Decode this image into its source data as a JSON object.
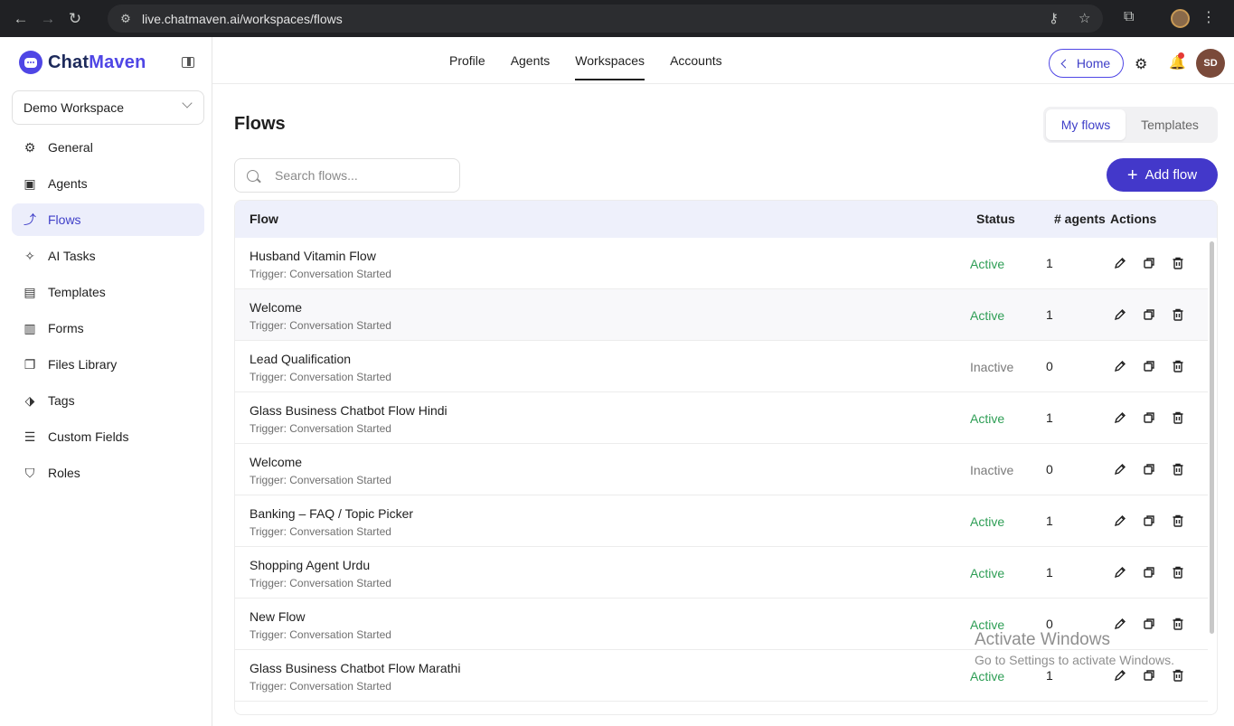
{
  "browser": {
    "url": "live.chatmaven.ai/workspaces/flows"
  },
  "brand": {
    "prefix": "Chat",
    "suffix": "Maven"
  },
  "workspace": {
    "selected": "Demo Workspace"
  },
  "sidebar": {
    "items": [
      {
        "label": "General",
        "icon": "gear-icon",
        "active": false
      },
      {
        "label": "Agents",
        "icon": "robot-icon",
        "active": false
      },
      {
        "label": "Flows",
        "icon": "flow-icon",
        "active": true
      },
      {
        "label": "AI Tasks",
        "icon": "sparkle-icon",
        "active": false
      },
      {
        "label": "Templates",
        "icon": "document-icon",
        "active": false
      },
      {
        "label": "Forms",
        "icon": "clipboard-icon",
        "active": false
      },
      {
        "label": "Files Library",
        "icon": "files-icon",
        "active": false
      },
      {
        "label": "Tags",
        "icon": "tag-icon",
        "active": false
      },
      {
        "label": "Custom Fields",
        "icon": "list-check-icon",
        "active": false
      },
      {
        "label": "Roles",
        "icon": "shield-icon",
        "active": false
      }
    ]
  },
  "topnav": {
    "tabs": [
      {
        "label": "Profile",
        "active": false
      },
      {
        "label": "Agents",
        "active": false
      },
      {
        "label": "Workspaces",
        "active": true
      },
      {
        "label": "Accounts",
        "active": false
      }
    ],
    "home_label": "Home",
    "avatar_initials": "SD"
  },
  "page": {
    "title": "Flows",
    "toggle": {
      "my_flows": "My flows",
      "templates": "Templates"
    },
    "search_placeholder": "Search flows...",
    "add_label": "Add flow"
  },
  "table": {
    "headers": {
      "flow": "Flow",
      "status": "Status",
      "agents": "# agents",
      "actions": "Actions"
    },
    "rows": [
      {
        "name": "Husband Vitamin Flow",
        "trigger": "Trigger: Conversation Started",
        "status": "Active",
        "agents": "1"
      },
      {
        "name": "Welcome",
        "trigger": "Trigger: Conversation Started",
        "status": "Active",
        "agents": "1"
      },
      {
        "name": "Lead Qualification",
        "trigger": "Trigger: Conversation Started",
        "status": "Inactive",
        "agents": "0"
      },
      {
        "name": "Glass Business Chatbot Flow Hindi",
        "trigger": "Trigger: Conversation Started",
        "status": "Active",
        "agents": "1"
      },
      {
        "name": "Welcome",
        "trigger": "Trigger: Conversation Started",
        "status": "Inactive",
        "agents": "0"
      },
      {
        "name": "Banking – FAQ / Topic Picker",
        "trigger": "Trigger: Conversation Started",
        "status": "Active",
        "agents": "1"
      },
      {
        "name": "Shopping Agent Urdu",
        "trigger": "Trigger: Conversation Started",
        "status": "Active",
        "agents": "1"
      },
      {
        "name": "New Flow",
        "trigger": "Trigger: Conversation Started",
        "status": "Active",
        "agents": "0"
      },
      {
        "name": "Glass Business Chatbot Flow Marathi",
        "trigger": "Trigger: Conversation Started",
        "status": "Active",
        "agents": "1"
      }
    ]
  },
  "watermark": {
    "line1": "Activate Windows",
    "line2": "Go to Settings to activate Windows."
  },
  "colors": {
    "accent": "#4338ca",
    "active_status": "#2e9e55",
    "inactive_status": "#7a7a7a"
  }
}
